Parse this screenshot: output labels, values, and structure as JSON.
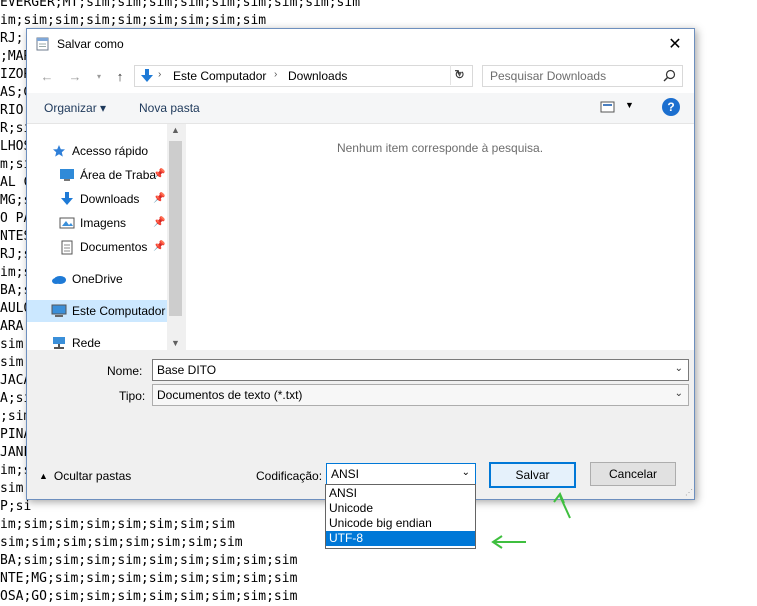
{
  "background_text": [
    "EVERGER;MT;sim;sim;sim;sim;sim;sim;sim;sim;sim",
    "im;sim;sim;sim;sim;sim;sim;sim;sim",
    "RJ;",
    ";MAR",
    "IZOR",
    "AS;G",
    "RIO",
    "R;si",
    "LHOS",
    "m;si",
    "AL C",
    "MG;s",
    "O PA",
    "NTES",
    "RJ;s",
    "im;s",
    "BA;s",
    "AULO",
    "ARA;",
    "sim;",
    "sim;",
    "JACA",
    "A;si",
    ";sim",
    "PINA",
    "JANE",
    "im;s",
    "sim;",
    "P;si",
    "im;sim;sim;sim;sim;sim;sim;sim",
    "sim;sim;sim;sim;sim;sim;sim;sim",
    "BA;sim;sim;sim;sim;sim;sim;sim;sim;sim",
    "NTE;MG;sim;sim;sim;sim;sim;sim;sim;sim",
    "OSA;GO;sim;sim;sim;sim;sim;sim;sim;sim"
  ],
  "dialog": {
    "title": "Salvar como",
    "close_icon": "close-icon"
  },
  "nav": {
    "breadcrumb": [
      "Este Computador",
      "Downloads"
    ],
    "search_placeholder": "Pesquisar Downloads"
  },
  "toolbar": {
    "organize_label": "Organizar ▾",
    "new_folder_label": "Nova pasta",
    "help_label": "?"
  },
  "sidebar": {
    "items": [
      {
        "label": "Acesso rápido",
        "icon": "star-icon"
      },
      {
        "label": "Área de Traba",
        "icon": "desktop-icon",
        "pinned": true
      },
      {
        "label": "Downloads",
        "icon": "download-icon",
        "pinned": true
      },
      {
        "label": "Imagens",
        "icon": "image-icon",
        "pinned": true
      },
      {
        "label": "Documentos",
        "icon": "document-icon",
        "pinned": true
      },
      {
        "label": "OneDrive",
        "icon": "cloud-icon"
      },
      {
        "label": "Este Computador",
        "icon": "computer-icon",
        "selected": true
      },
      {
        "label": "Rede",
        "icon": "network-icon"
      }
    ]
  },
  "content": {
    "empty_message": "Nenhum item corresponde à pesquisa."
  },
  "form": {
    "name_label": "Nome:",
    "name_value": "Base DITO",
    "type_label": "Tipo:",
    "type_value": "Documentos de texto (*.txt)"
  },
  "footer": {
    "hide_folders_label": "Ocultar pastas",
    "encoding_label": "Codificação:",
    "encoding_value": "ANSI",
    "save_label": "Salvar",
    "cancel_label": "Cancelar"
  },
  "encoding_options": [
    "ANSI",
    "Unicode",
    "Unicode big endian",
    "UTF-8"
  ],
  "encoding_highlighted": "UTF-8",
  "colors": {
    "accent": "#0078d7",
    "annotation_arrow": "#3fbf3f",
    "selected_bg": "#cce8ff"
  }
}
